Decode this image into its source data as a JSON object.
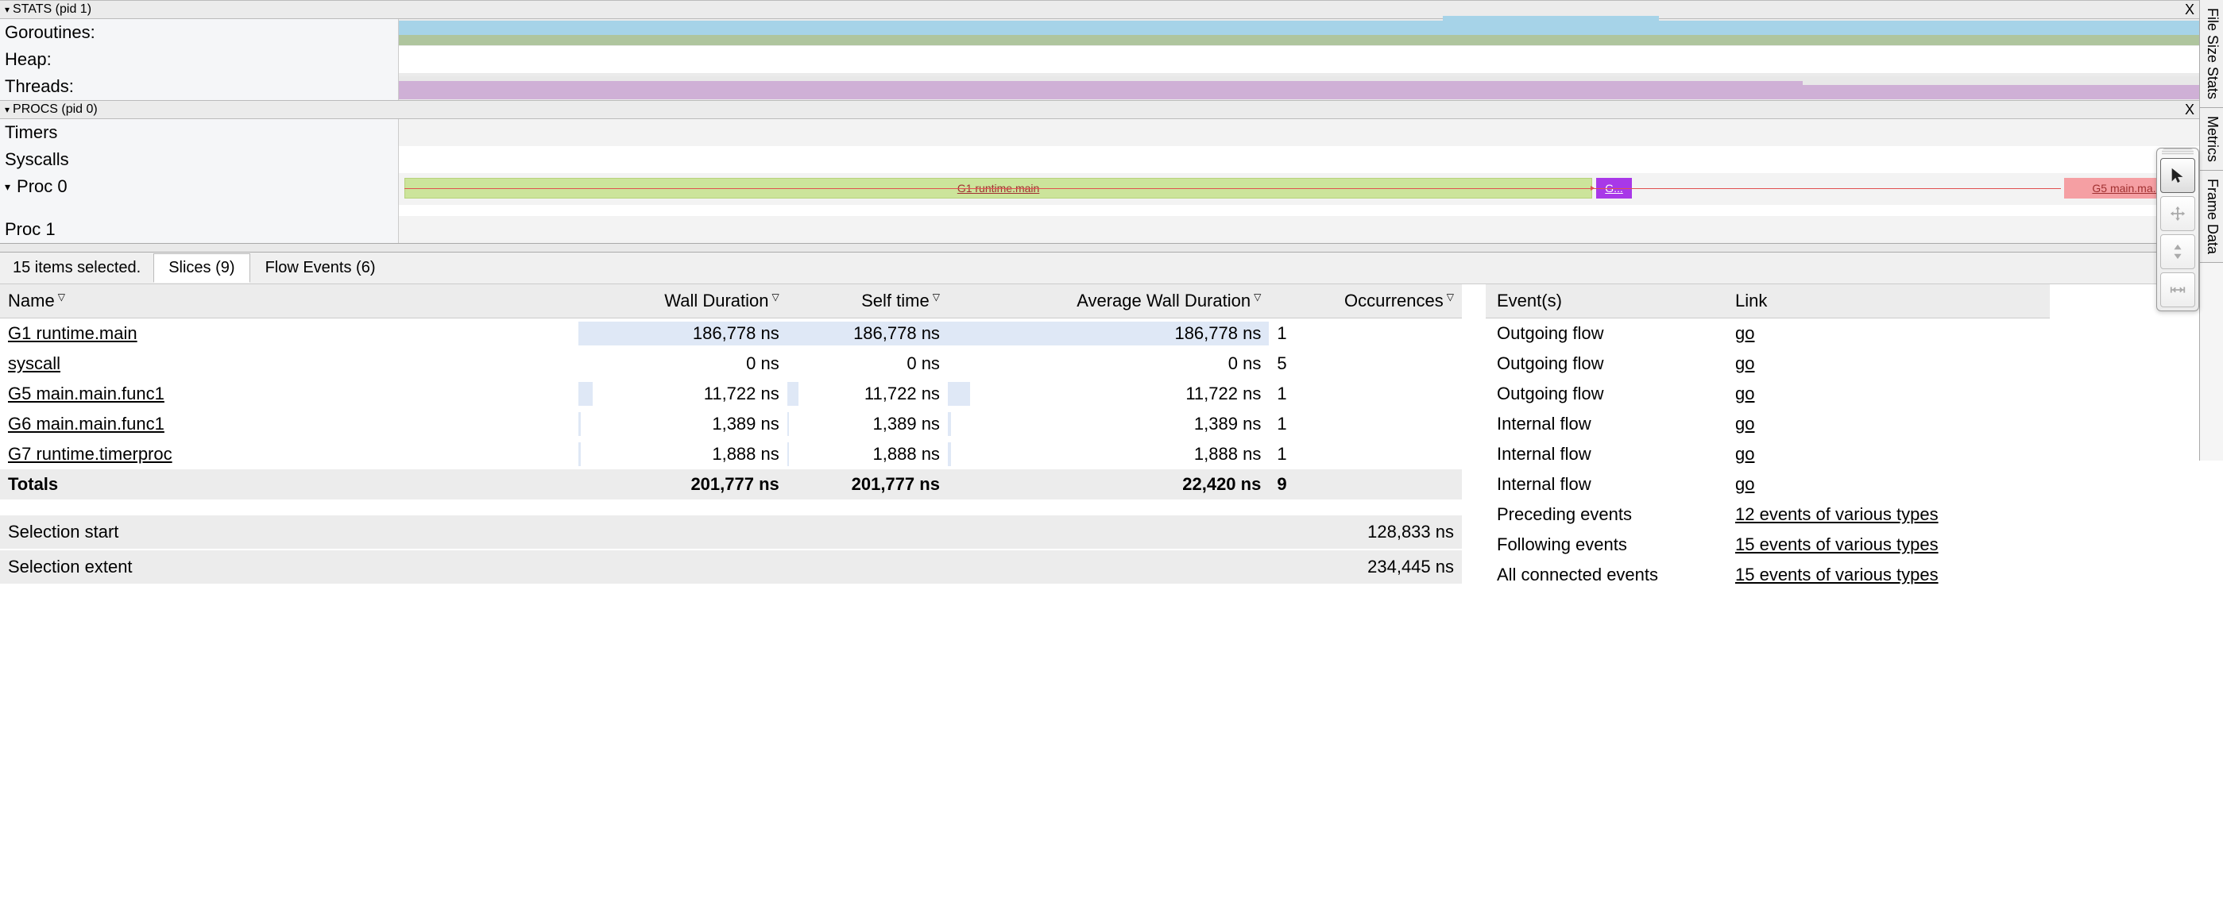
{
  "groups": {
    "stats": {
      "title": "STATS (pid 1)",
      "close": "X"
    },
    "procs": {
      "title": "PROCS (pid 0)",
      "close": "X"
    }
  },
  "stat_rows": {
    "goroutines": "Goroutines:",
    "heap": "Heap:",
    "threads": "Threads:"
  },
  "proc_rows": {
    "timers": "Timers",
    "syscalls": "Syscalls",
    "proc0": "Proc 0",
    "proc1": "Proc 1"
  },
  "slice_labels": {
    "g1": "G1 runtime.main",
    "g_short": "G...",
    "g5": "G5 main.ma..."
  },
  "right_tabs": {
    "file_size": "File Size Stats",
    "metrics": "Metrics",
    "frame_data": "Frame Data"
  },
  "bottom": {
    "summary": "15 items selected.",
    "tab_slices": "Slices (9)",
    "tab_flow": "Flow Events (6)"
  },
  "columns": {
    "name": "Name",
    "wall": "Wall Duration",
    "self": "Self time",
    "avg": "Average Wall Duration",
    "occ": "Occurrences"
  },
  "rows": [
    {
      "name": "G1 runtime.main",
      "wall": "186,778 ns",
      "self": "186,778 ns",
      "avg": "186,778 ns",
      "occ": "1",
      "wp": 100,
      "sp": 100,
      "ap": 100
    },
    {
      "name": "syscall",
      "wall": "0 ns",
      "self": "0 ns",
      "avg": "0 ns",
      "occ": "5",
      "wp": 0,
      "sp": 0,
      "ap": 0
    },
    {
      "name": "G5 main.main.func1",
      "wall": "11,722 ns",
      "self": "11,722 ns",
      "avg": "11,722 ns",
      "occ": "1",
      "wp": 7,
      "sp": 7,
      "ap": 7
    },
    {
      "name": "G6 main.main.func1",
      "wall": "1,389 ns",
      "self": "1,389 ns",
      "avg": "1,389 ns",
      "occ": "1",
      "wp": 1,
      "sp": 1,
      "ap": 1
    },
    {
      "name": "G7 runtime.timerproc",
      "wall": "1,888 ns",
      "self": "1,888 ns",
      "avg": "1,888 ns",
      "occ": "1",
      "wp": 1,
      "sp": 1,
      "ap": 1
    }
  ],
  "totals": {
    "label": "Totals",
    "wall": "201,777 ns",
    "self": "201,777 ns",
    "avg": "22,420 ns",
    "occ": "9"
  },
  "selection": {
    "start_label": "Selection start",
    "start_val": "128,833 ns",
    "extent_label": "Selection extent",
    "extent_val": "234,445 ns"
  },
  "events": {
    "col_event": "Event(s)",
    "col_link": "Link",
    "rows": [
      {
        "event": "Outgoing flow",
        "link": "go"
      },
      {
        "event": "Outgoing flow",
        "link": "go"
      },
      {
        "event": "Outgoing flow",
        "link": "go"
      },
      {
        "event": "Internal flow",
        "link": "go"
      },
      {
        "event": "Internal flow",
        "link": "go"
      },
      {
        "event": "Internal flow",
        "link": "go"
      },
      {
        "event": "Preceding events",
        "link": "12 events of various types"
      },
      {
        "event": "Following events",
        "link": "15 events of various types"
      },
      {
        "event": "All connected events",
        "link": "15 events of various types"
      }
    ]
  }
}
